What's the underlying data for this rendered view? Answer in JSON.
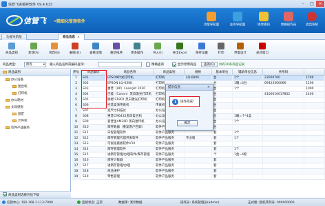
{
  "window": {
    "title": "信管飞进销存软件 V9.4.613",
    "min": "–",
    "max": "□",
    "close": "×"
  },
  "header": {
    "brand": "信管飞",
    "slogan": "•精细化管理软件",
    "buttons": [
      {
        "label": "功能导航面",
        "color": "#f0a030"
      },
      {
        "label": "业务导航面",
        "color": "#3aa0e0"
      },
      {
        "label": "修改密码",
        "color": "#f1c232"
      },
      {
        "label": "更换操作员",
        "color": "#e06666"
      },
      {
        "label": "退出系统",
        "color": "#cc3333"
      }
    ]
  },
  "tabs": [
    {
      "label": "功能导航图"
    },
    {
      "label": "商品信息"
    }
  ],
  "toolbar": [
    {
      "label": "商品类别",
      "color": "#5b9bd5"
    },
    {
      "label": "新增(A)",
      "color": "#6aa84f"
    },
    {
      "label": "修改(B)",
      "color": "#e69138"
    },
    {
      "label": "删除(D)",
      "color": "#cc4125"
    },
    {
      "label": "查看详情",
      "color": "#3d85c6"
    },
    {
      "label": "重新排序",
      "color": "#674ea7"
    },
    {
      "label": "更多操作",
      "color": "#45818e"
    },
    {
      "label": "导入(I)",
      "color": "#6aa84f"
    },
    {
      "label": "导出Excel",
      "color": "#38761d"
    },
    {
      "label": "保存设置",
      "color": "#3c78d8"
    },
    {
      "label": "打印",
      "color": "#666666"
    },
    {
      "label": "界面设计",
      "color": "#b45f06"
    },
    {
      "label": "关闭窗口",
      "color": "#cc0000"
    }
  ],
  "filter": {
    "type_label": "商品类型:",
    "type_value": "所有",
    "search_label": "输入商品名称或编码查询:",
    "exact_label": "精确查询",
    "show_disabled_label": "显示停用商品",
    "query_btn": "查询(Q)",
    "count_text": "共有20条商品记录"
  },
  "tree": {
    "title": "商品类别",
    "nodes": [
      "办公设备",
      "复合机",
      "打印机",
      "办公耗材",
      "文具纸张",
      "固定",
      "计件机",
      "软件产品服务"
    ],
    "footer": "商品类别选择包括下级"
  },
  "grid": {
    "headers": [
      "序号",
      "商品编码",
      "商品名称",
      "商品类别",
      "规格",
      "基本单位",
      "辅助单位信息",
      "条形码",
      ""
    ],
    "rows": [
      [
        "1",
        "S01",
        "EPSON针式打印机",
        "打印机",
        "LQ-680K",
        "台",
        "1个",
        "23000760",
        "1789"
      ],
      [
        "2",
        "S02",
        "EPSON LQ-630K",
        "打印机",
        "",
        "台",
        "1箱=4台",
        "69423300066",
        "1100"
      ],
      [
        "3",
        "S03",
        "惠普（HP）LaserJet 1020",
        "打印机",
        "",
        "台",
        "1个",
        "",
        "1000"
      ],
      [
        "4",
        "S04",
        "佳能（Canon）黑白激光打印机",
        "打印机",
        "",
        "台",
        "",
        "4100010017802",
        "1400"
      ],
      [
        "5",
        "S05",
        "联想 S1801 黑白激光打印机",
        "打印机",
        "",
        "台",
        "",
        "",
        ""
      ],
      [
        "6",
        "S06",
        "托普高清传真机",
        "传真机",
        "",
        "台",
        "",
        "",
        ""
      ],
      [
        "7",
        "S07",
        "宽尺寸扫描仪",
        "办公设备",
        "",
        "台",
        "",
        "",
        ""
      ],
      [
        "8",
        "S08",
        "惠普CM6432黑白复合机",
        "办公设备",
        "",
        "台",
        "1箱=个*4盒",
        "",
        ""
      ],
      [
        "9",
        "S09",
        "爱普生AM30D 黑白复印机",
        "办公设备",
        "CU-900/20150",
        "台",
        "1个",
        "",
        ""
      ],
      [
        "10",
        "S10",
        "库存数器（重复客户回调）",
        "软件产品服务",
        "",
        "台",
        "",
        "",
        ""
      ],
      [
        "11",
        "S11",
        "日程管理软件",
        "软件产品服务",
        "",
        "套",
        "1个",
        "",
        ""
      ],
      [
        "12",
        "S12",
        "库存管理代理开发软件",
        "软件产品服务",
        "专业版",
        "套",
        "1个",
        "",
        ""
      ],
      [
        "13",
        "S13",
        "可视化看板软件V10",
        "软件产品服务",
        "",
        "套",
        "",
        "",
        ""
      ],
      [
        "14",
        "S14",
        "库存管理软件",
        "软件产品服务",
        "",
        "套",
        "1个",
        "",
        ""
      ],
      [
        "15",
        "S15",
        "进销存管理/办理软件/库存管理",
        "软件产品服务",
        "",
        "个",
        "1盒=4套",
        "",
        ""
      ],
      [
        "16",
        "S16",
        "库存计数器",
        "软件产品服务",
        "",
        "套",
        "",
        "",
        ""
      ],
      [
        "17",
        "S17",
        "进销存管理/办理",
        "软件产品服务",
        "",
        "套",
        "",
        "",
        ""
      ],
      [
        "18",
        "S18",
        "商品维护",
        "软件产品服务",
        "",
        "套",
        "",
        "",
        ""
      ],
      [
        "19",
        "S19",
        "零售管理",
        "软件产品服务",
        "",
        "套",
        "",
        "",
        ""
      ]
    ]
  },
  "dialog": {
    "title": "提示信息",
    "message": "操作完成!",
    "ok": "确定",
    "close": "×"
  },
  "status": {
    "server": "信管中心: 192.168.1.113:7090",
    "conn": "连接状态: 正常",
    "store": "数据库: 演示数据",
    "operator": "操作员: 系统管理员(admin)",
    "version": "正式版: 授权序列号: 000000000"
  }
}
